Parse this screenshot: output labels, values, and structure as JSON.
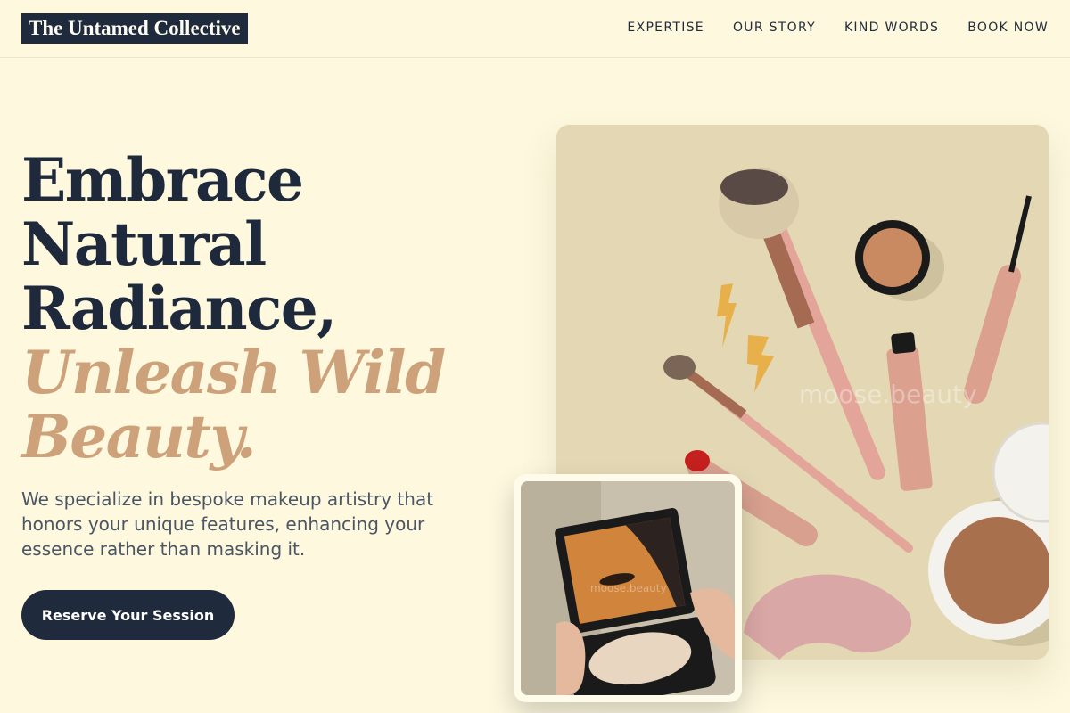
{
  "brand": {
    "name": "The Untamed Collective"
  },
  "nav": {
    "items": [
      {
        "label": "EXPERTISE"
      },
      {
        "label": "OUR STORY"
      },
      {
        "label": "KIND WORDS"
      },
      {
        "label": "BOOK NOW"
      }
    ]
  },
  "hero": {
    "title_lines": [
      "Embrace",
      "Natural",
      "Radiance,"
    ],
    "accent_lines": [
      "Unleash Wild",
      "Beauty."
    ],
    "description": "We specialize in bespoke makeup artistry that honors your unique features, enhancing your essence rather than masking it.",
    "cta_label": "Reserve Your Session"
  },
  "images": {
    "main_watermark": "moose.beauty",
    "small_watermark": "moose.beauty"
  },
  "colors": {
    "background": "#fdf8de",
    "navy": "#1f2a3d",
    "accent": "#cda27a",
    "main_image_bg": "#e4d8b4"
  }
}
